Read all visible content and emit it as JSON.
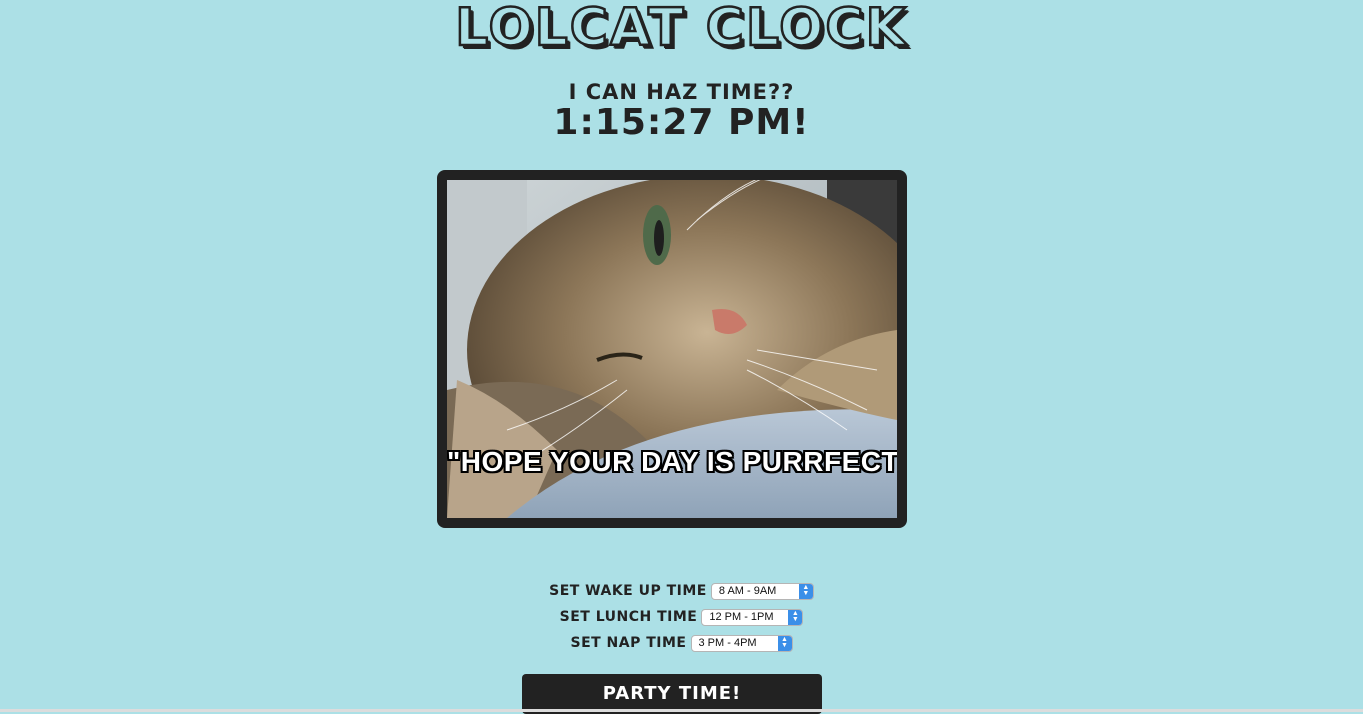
{
  "app": {
    "title": "LOLCAT CLOCK"
  },
  "clock": {
    "subtitle": "I CAN HAZ TIME??",
    "time": "1:15:27 PM!"
  },
  "photo": {
    "caption": "\"HOPE YOUR DAY IS PURRFECT!\""
  },
  "controls": {
    "wake": {
      "label": "SET WAKE UP TIME",
      "value": "8 AM - 9AM"
    },
    "lunch": {
      "label": "SET LUNCH TIME",
      "value": "12 PM - 1PM"
    },
    "nap": {
      "label": "SET NAP TIME",
      "value": "3 PM - 4PM"
    },
    "party_button": "PARTY TIME!"
  },
  "colors": {
    "background": "#ace0e6",
    "frame": "#222222",
    "select_accent": "#3b8fe8"
  }
}
